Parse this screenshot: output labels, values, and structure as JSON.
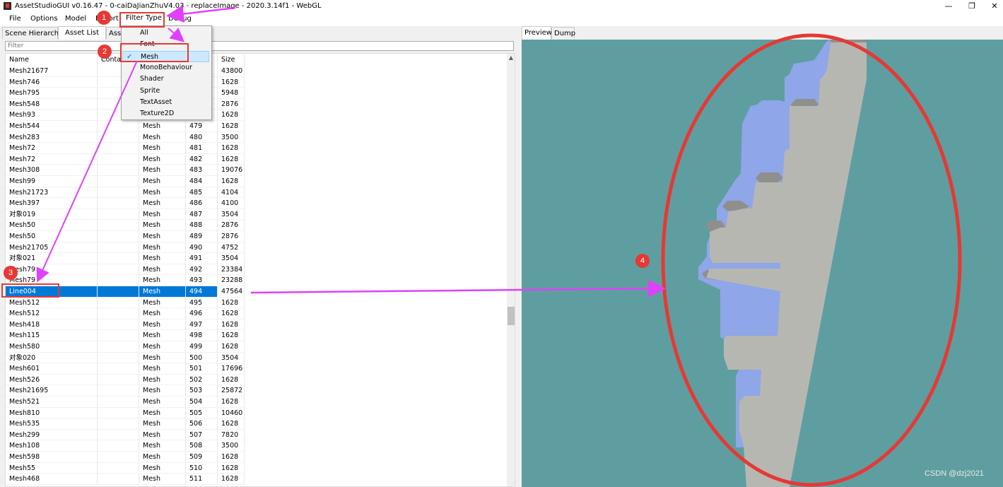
{
  "window": {
    "title": "AssetStudioGUI v0.16.47 - 0-caiDaJianZhuV4.03 - replaceImage - 2020.3.14f1 - WebGL",
    "controls": {
      "minimize": "—",
      "maximize": "❐",
      "close": "✕"
    }
  },
  "menu": {
    "file": "File",
    "options": "Options",
    "model": "Model",
    "export": "Export",
    "filter_type": "Filter Type",
    "debug": "Debug"
  },
  "tabs": {
    "scene_hierarchy": "Scene Hierarchy",
    "asset_list": "Asset List",
    "asset_classes": "Asse"
  },
  "filter": {
    "placeholder": "Filter"
  },
  "columns": {
    "name": "Name",
    "container": "Contai",
    "type": "Type",
    "pathid": "PathID",
    "size": "Size"
  },
  "dropdown": {
    "items": [
      "All",
      "Font",
      "Mesh",
      "MonoBehaviour",
      "Shader",
      "Sprite",
      "TextAsset",
      "Texture2D"
    ],
    "checked": "Mesh"
  },
  "assets": [
    {
      "name": "Mesh21677",
      "container": "",
      "type": "",
      "pathid": "",
      "size": "43800"
    },
    {
      "name": "Mesh746",
      "container": "",
      "type": "",
      "pathid": "",
      "size": "1628"
    },
    {
      "name": "Mesh795",
      "container": "",
      "type": "",
      "pathid": "",
      "size": "5948"
    },
    {
      "name": "Mesh548",
      "container": "",
      "type": "",
      "pathid": "",
      "size": "2876"
    },
    {
      "name": "Mesh93",
      "container": "",
      "type": "",
      "pathid": "",
      "size": "1628"
    },
    {
      "name": "Mesh544",
      "container": "",
      "type": "Mesh",
      "pathid": "479",
      "size": "1628"
    },
    {
      "name": "Mesh283",
      "container": "",
      "type": "Mesh",
      "pathid": "480",
      "size": "3500"
    },
    {
      "name": "Mesh72",
      "container": "",
      "type": "Mesh",
      "pathid": "481",
      "size": "1628"
    },
    {
      "name": "Mesh72",
      "container": "",
      "type": "Mesh",
      "pathid": "482",
      "size": "1628"
    },
    {
      "name": "Mesh308",
      "container": "",
      "type": "Mesh",
      "pathid": "483",
      "size": "19076"
    },
    {
      "name": "Mesh99",
      "container": "",
      "type": "Mesh",
      "pathid": "484",
      "size": "1628"
    },
    {
      "name": "Mesh21723",
      "container": "",
      "type": "Mesh",
      "pathid": "485",
      "size": "4104"
    },
    {
      "name": "Mesh397",
      "container": "",
      "type": "Mesh",
      "pathid": "486",
      "size": "4100"
    },
    {
      "name": "对象019",
      "container": "",
      "type": "Mesh",
      "pathid": "487",
      "size": "3504"
    },
    {
      "name": "Mesh50",
      "container": "",
      "type": "Mesh",
      "pathid": "488",
      "size": "2876"
    },
    {
      "name": "Mesh50",
      "container": "",
      "type": "Mesh",
      "pathid": "489",
      "size": "2876"
    },
    {
      "name": "Mesh21705",
      "container": "",
      "type": "Mesh",
      "pathid": "490",
      "size": "4752"
    },
    {
      "name": "对象021",
      "container": "",
      "type": "Mesh",
      "pathid": "491",
      "size": "3504"
    },
    {
      "name": "Mesh79",
      "container": "",
      "type": "Mesh",
      "pathid": "492",
      "size": "23384"
    },
    {
      "name": "Mesh79",
      "container": "",
      "type": "Mesh",
      "pathid": "493",
      "size": "23288"
    },
    {
      "name": "Line004",
      "container": "",
      "type": "Mesh",
      "pathid": "494",
      "size": "47564"
    },
    {
      "name": "Mesh512",
      "container": "",
      "type": "Mesh",
      "pathid": "495",
      "size": "1628"
    },
    {
      "name": "Mesh512",
      "container": "",
      "type": "Mesh",
      "pathid": "496",
      "size": "1628"
    },
    {
      "name": "Mesh418",
      "container": "",
      "type": "Mesh",
      "pathid": "497",
      "size": "1628"
    },
    {
      "name": "Mesh115",
      "container": "",
      "type": "Mesh",
      "pathid": "498",
      "size": "1628"
    },
    {
      "name": "Mesh580",
      "container": "",
      "type": "Mesh",
      "pathid": "499",
      "size": "1628"
    },
    {
      "name": "对象020",
      "container": "",
      "type": "Mesh",
      "pathid": "500",
      "size": "3504"
    },
    {
      "name": "Mesh601",
      "container": "",
      "type": "Mesh",
      "pathid": "501",
      "size": "17696"
    },
    {
      "name": "Mesh526",
      "container": "",
      "type": "Mesh",
      "pathid": "502",
      "size": "1628"
    },
    {
      "name": "Mesh21695",
      "container": "",
      "type": "Mesh",
      "pathid": "503",
      "size": "25872"
    },
    {
      "name": "Mesh521",
      "container": "",
      "type": "Mesh",
      "pathid": "504",
      "size": "1628"
    },
    {
      "name": "Mesh810",
      "container": "",
      "type": "Mesh",
      "pathid": "505",
      "size": "10460"
    },
    {
      "name": "Mesh535",
      "container": "",
      "type": "Mesh",
      "pathid": "506",
      "size": "1628"
    },
    {
      "name": "Mesh299",
      "container": "",
      "type": "Mesh",
      "pathid": "507",
      "size": "7820"
    },
    {
      "name": "Mesh108",
      "container": "",
      "type": "Mesh",
      "pathid": "508",
      "size": "3500"
    },
    {
      "name": "Mesh598",
      "container": "",
      "type": "Mesh",
      "pathid": "509",
      "size": "1628"
    },
    {
      "name": "Mesh55",
      "container": "",
      "type": "Mesh",
      "pathid": "510",
      "size": "1628"
    },
    {
      "name": "Mesh468",
      "container": "",
      "type": "Mesh",
      "pathid": "511",
      "size": "1628"
    }
  ],
  "selected_row": 20,
  "right_tabs": {
    "preview": "Preview",
    "dump": "Dump"
  },
  "annotations": {
    "step1": "1",
    "step2": "2",
    "step3": "3",
    "step4": "4"
  },
  "colors": {
    "selection": "#0078d7",
    "annotation": "#e53935",
    "arrow": "#e040fb",
    "preview_bg": "#5f9ea0",
    "mesh": "#b7b7b2"
  },
  "watermark": "CSDN @dzj2021"
}
